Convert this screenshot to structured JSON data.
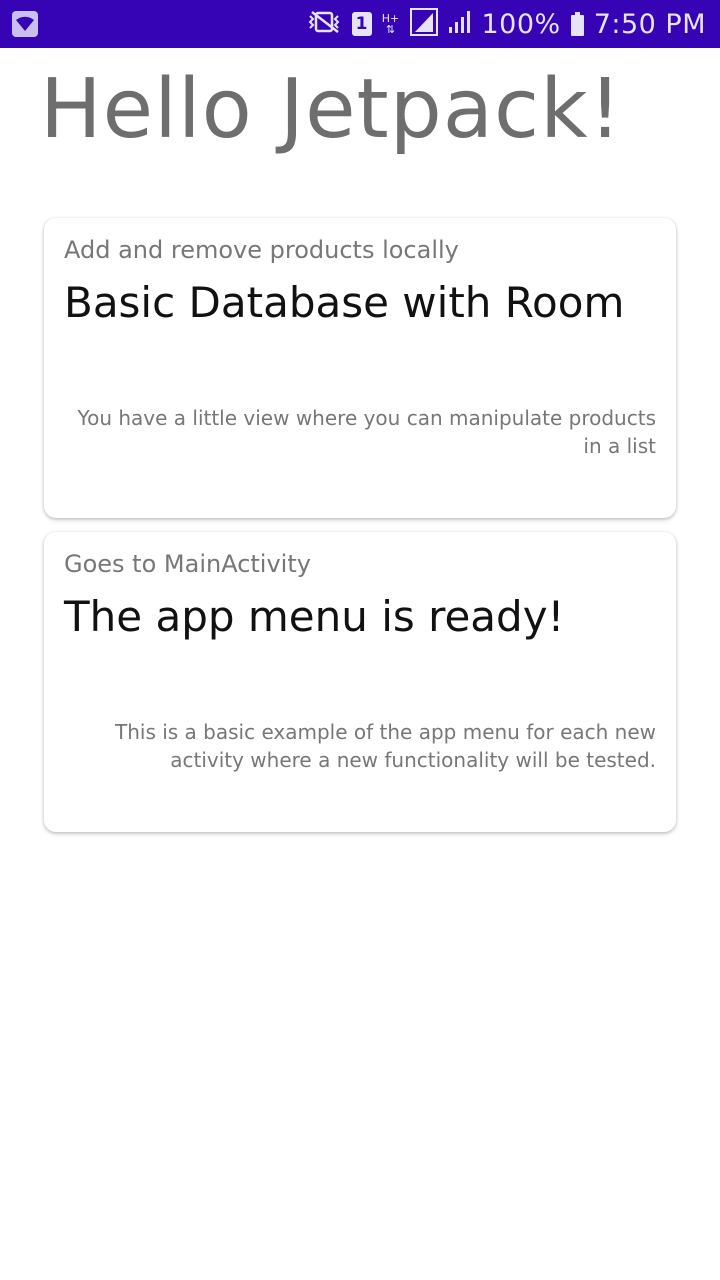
{
  "status_bar": {
    "background": "#3604b5",
    "sim_slot": "1",
    "network_type": "H+",
    "battery": "100%",
    "time": "7:50 PM",
    "icons": [
      "wifi-icon",
      "vibrate-icon",
      "sim-1-icon",
      "data-arrows-icon",
      "signal-icon",
      "signal-icon",
      "battery-icon"
    ]
  },
  "page": {
    "title": "Hello Jetpack!"
  },
  "cards": [
    {
      "subtitle": "Add and remove products locally",
      "title": "Basic Database with Room",
      "description": "You have a little view where you can manipulate products in a list"
    },
    {
      "subtitle": "Goes to MainActivity",
      "title": "The app menu is ready!",
      "description": "This is a basic example of the app menu for each new activity where a new functionality will be tested."
    }
  ]
}
